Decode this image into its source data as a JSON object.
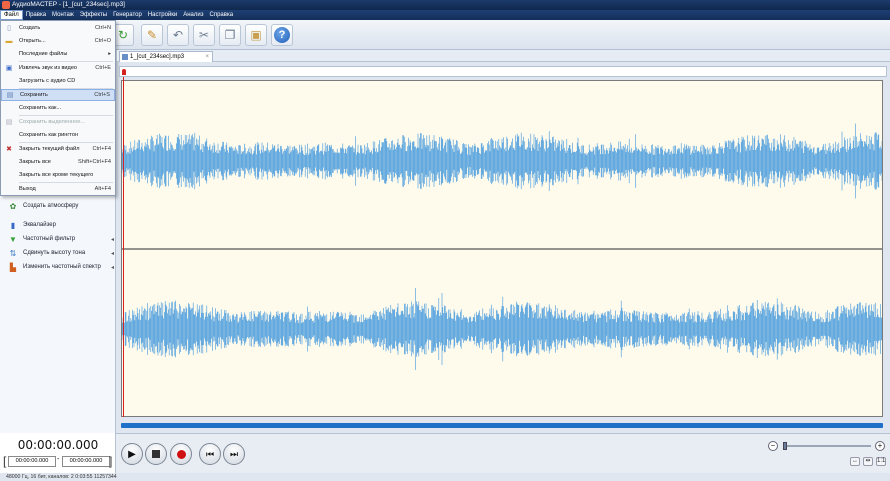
{
  "window": {
    "title": "АудиоМАСТЕР - [1_[cut_234sec].mp3]"
  },
  "menubar": [
    "Файл",
    "Правка",
    "Монтаж",
    "Эффекты",
    "Генератор",
    "Настройки",
    "Анализ",
    "Справка"
  ],
  "file_menu": [
    {
      "label": "Создать",
      "shortcut": "Ctrl+N",
      "icon": "new-file-icon"
    },
    {
      "label": "Открыть...",
      "shortcut": "Ctrl+O",
      "icon": "open-folder-icon"
    },
    {
      "label": "Последние файлы",
      "shortcut": "",
      "icon": "",
      "submenu": true
    },
    {
      "label": "Извлечь звук из видео",
      "shortcut": "Ctrl+E",
      "icon": "video-icon"
    },
    {
      "label": "Загрузить с аудио CD",
      "shortcut": "",
      "icon": "cd-icon"
    },
    {
      "label": "Сохранить",
      "shortcut": "Ctrl+S",
      "icon": "save-icon",
      "highlight": true
    },
    {
      "label": "Сохранить как...",
      "shortcut": "",
      "icon": ""
    },
    {
      "label": "Сохранить выделенное...",
      "shortcut": "",
      "icon": "save-selection-icon",
      "disabled": true
    },
    {
      "label": "Сохранить как рингтон",
      "shortcut": "",
      "icon": ""
    },
    {
      "label": "Закрыть текущий файл",
      "shortcut": "Ctrl+F4",
      "icon": "close-file-icon"
    },
    {
      "label": "Закрыть все",
      "shortcut": "Shift+Ctrl+F4",
      "icon": ""
    },
    {
      "label": "Закрыть все кроме текущего",
      "shortcut": "",
      "icon": ""
    },
    {
      "label": "Выход",
      "shortcut": "Alt+F4",
      "icon": ""
    }
  ],
  "sidebar": [
    {
      "label": "Создать атмосферу",
      "icon": "atmosphere-icon",
      "arrow": false
    },
    {
      "label": "Эквалайзер",
      "icon": "equalizer-icon",
      "arrow": false
    },
    {
      "label": "Частотный фильтр",
      "icon": "filter-icon",
      "arrow": true
    },
    {
      "label": "Сдвинуть высоту тона",
      "icon": "pitch-icon",
      "arrow": true
    },
    {
      "label": "Изменить частотный спектр",
      "icon": "spectrum-icon",
      "arrow": true
    }
  ],
  "tab": {
    "label": "1_[cut_234sec].mp3",
    "close": "×"
  },
  "time": {
    "current": "00:00:00.000",
    "start": "00:00:00.000",
    "end": "00:00:00.000",
    "dash": "-"
  },
  "playback": {
    "play": "play-icon",
    "stop": "stop-icon",
    "record": "record-icon",
    "prev": "skip-back-icon",
    "next": "skip-forward-icon"
  },
  "zoom": {
    "minus": "−",
    "plus": "+",
    "fit_label": "1:1",
    "fit_width": "↔",
    "fit_sel": "⇹"
  },
  "status": "48000 Гц, 16 бит, каналов: 2   0:03:55 11257344"
}
